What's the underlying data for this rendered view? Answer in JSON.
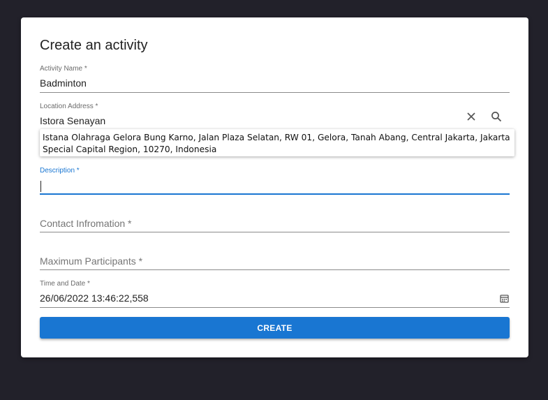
{
  "form": {
    "title": "Create an activity",
    "activity_name": {
      "label": "Activity Name *",
      "value": "Badminton"
    },
    "location_address": {
      "label": "Location Address *",
      "value": "Istora Senayan",
      "suggestion_line1": "Istana Olahraga Gelora Bung Karno, Jalan Plaza Selatan, RW 01, Gelora, Tanah Abang, Central Jakarta, Jakarta",
      "suggestion_line2": "Special Capital Region, 10270, Indonesia"
    },
    "description": {
      "label": "Description *",
      "value": ""
    },
    "contact_information": {
      "placeholder": "Contact Infromation *"
    },
    "maximum_participants": {
      "placeholder": "Maximum Participants *"
    },
    "time_and_date": {
      "label": "Time and Date *",
      "value": "26/06/2022 13:46:22,558"
    },
    "create_label": "CREATE"
  },
  "colors": {
    "background": "#22212a",
    "card": "#ffffff",
    "accent": "#1976d2"
  },
  "icons": [
    "clear-icon",
    "search-icon",
    "calendar-icon"
  ]
}
